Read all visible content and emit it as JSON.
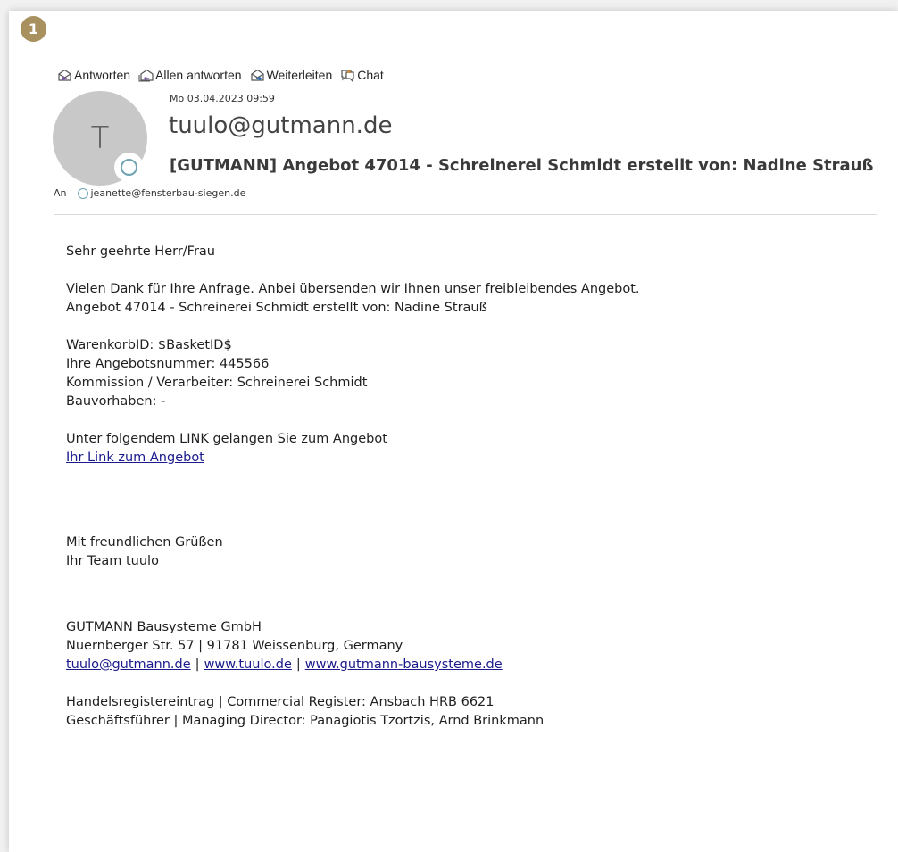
{
  "step_badge": "1",
  "toolbar": {
    "reply_label": "Antworten",
    "reply_all_label": "Allen antworten",
    "forward_label": "Weiterleiten",
    "chat_label": "Chat"
  },
  "colors": {
    "badge": "#a8905f",
    "avatar_bg": "#c8c8c8",
    "presence": "#6ea3b2",
    "link": "#1a1a8c",
    "icon_purple": "#7a55a8"
  },
  "header": {
    "avatar_initial": "T",
    "date": "Mo 03.04.2023 09:59",
    "sender": "tuulo@gutmann.de",
    "subject": "[GUTMANN] Angebot 47014 - Schreinerei Schmidt erstellt von: Nadine Strauß",
    "to_label": "An",
    "recipient": "jeanette@fensterbau-siegen.de"
  },
  "body": {
    "greeting": "Sehr geehrte Herr/Frau",
    "intro_1": "Vielen Dank für Ihre Anfrage. Anbei übersenden wir Ihnen unser freibleibendes Angebot.",
    "intro_2": "Angebot 47014 - Schreinerei Schmidt erstellt von: Nadine Strauß",
    "basket": "WarenkorbID: $BasketID$",
    "offer_number": "Ihre Angebotsnummer: 445566",
    "commission": "Kommission / Verarbeiter: Schreinerei Schmidt",
    "project": "Bauvorhaben: -",
    "link_intro": "Unter folgendem LINK gelangen Sie zum Angebot",
    "link_label": "Ihr Link zum Angebot",
    "closing_1": "Mit freundlichen Grüßen",
    "closing_2": "Ihr Team tuulo"
  },
  "signature": {
    "company": "GUTMANN Bausysteme GmbH",
    "address": "Nuernberger Str. 57 | 91781 Weissenburg, Germany",
    "email": "tuulo@gutmann.de",
    "web_1": "www.tuulo.de",
    "web_2": "www.gutmann-bausysteme.de",
    "separator": "|",
    "register": "Handelsregistereintrag | Commercial Register: Ansbach HRB 6621",
    "directors": "Geschäftsführer | Managing Director: Panagiotis Tzortzis, Arnd Brinkmann"
  }
}
